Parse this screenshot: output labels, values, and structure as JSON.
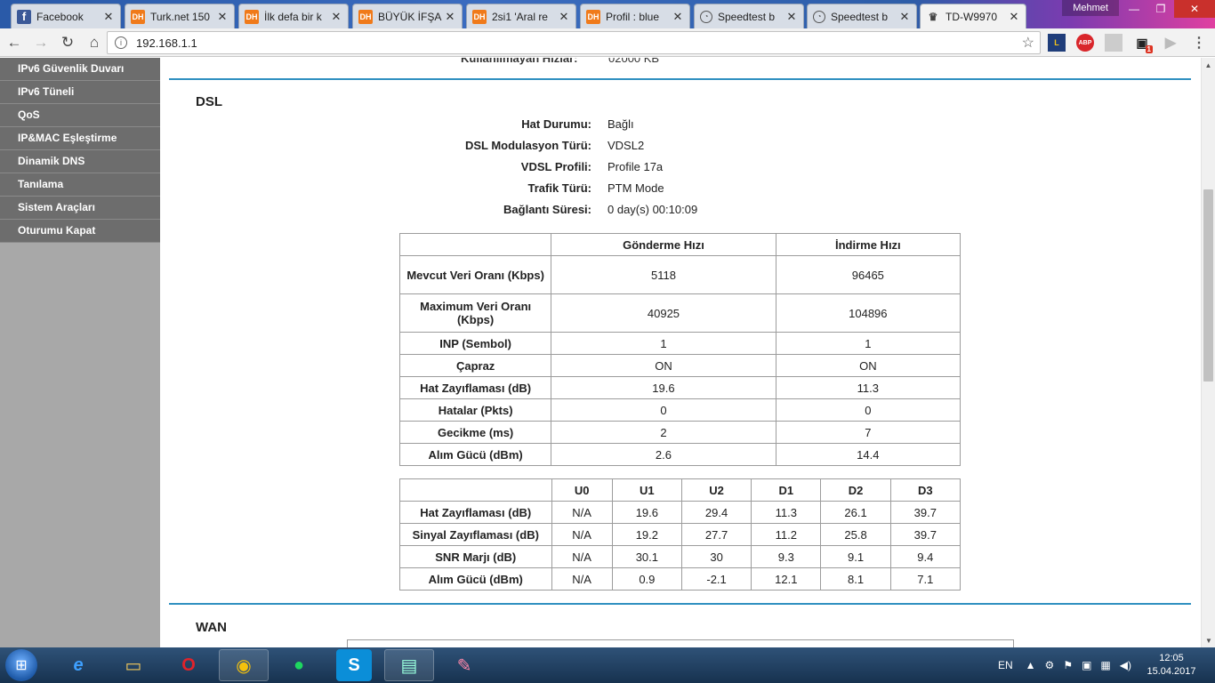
{
  "browser": {
    "tabs": [
      {
        "title": "Facebook",
        "favicon": "facebook-icon",
        "fav_text": "f",
        "active": false
      },
      {
        "title": "Turk.net 150",
        "favicon": "dh-icon",
        "fav_text": "DH",
        "active": false
      },
      {
        "title": "İlk defa bir k",
        "favicon": "dh-icon",
        "fav_text": "DH",
        "active": false
      },
      {
        "title": "BÜYÜK İFŞA",
        "favicon": "dh-icon",
        "fav_text": "DH",
        "active": false
      },
      {
        "title": "2si1 'Aral re",
        "favicon": "dh-icon",
        "fav_text": "DH",
        "active": false
      },
      {
        "title": "Profil : blue",
        "favicon": "dh-icon",
        "fav_text": "DH",
        "active": false
      },
      {
        "title": "Speedtest b",
        "favicon": "speedtest-icon",
        "fav_text": "◔",
        "active": false
      },
      {
        "title": "Speedtest b",
        "favicon": "speedtest-icon",
        "fav_text": "◔",
        "active": false
      },
      {
        "title": "TD-W9970",
        "favicon": "tplink-icon",
        "fav_text": "♛",
        "active": true
      }
    ],
    "close_glyph": "✕",
    "user_name": "Mehmet",
    "window_buttons": {
      "minimize": "—",
      "maximize": "❐",
      "close": "✕"
    },
    "url": "192.168.1.1",
    "nav": {
      "back": "←",
      "forward": "→",
      "reload": "↻",
      "home": "⌂"
    },
    "info_glyph": "i",
    "star_glyph": "☆",
    "extensions": {
      "abp": "ABP",
      "badge": "1"
    }
  },
  "sidebar": {
    "items": [
      "IPv6 Güvenlik Duvarı",
      "IPv6 Tüneli",
      "QoS",
      "IP&MAC Eşleştirme",
      "Dinamik DNS",
      "Tanılama",
      "Sistem Araçları",
      "Oturumu Kapat"
    ]
  },
  "dsl": {
    "title": "DSL",
    "fields": [
      {
        "label": "Hat Durumu:",
        "value": "Bağlı"
      },
      {
        "label": "DSL Modulasyon Türü:",
        "value": "VDSL2"
      },
      {
        "label": "VDSL Profili:",
        "value": "Profile 17a"
      },
      {
        "label": "Trafik Türü:",
        "value": "PTM Mode"
      },
      {
        "label": "Bağlantı Süresi:",
        "value": "0 day(s) 00:10:09"
      }
    ],
    "rate_table": {
      "headers": [
        "",
        "Gönderme Hızı",
        "İndirme Hızı"
      ],
      "rows": [
        {
          "label": "Mevcut Veri Oranı (Kbps)",
          "up": "5118",
          "down": "96465"
        },
        {
          "label": "Maximum Veri Oranı (Kbps)",
          "up": "40925",
          "down": "104896"
        },
        {
          "label": "INP (Sembol)",
          "up": "1",
          "down": "1"
        },
        {
          "label": "Çapraz",
          "up": "ON",
          "down": "ON"
        },
        {
          "label": "Hat Zayıflaması (dB)",
          "up": "19.6",
          "down": "11.3"
        },
        {
          "label": "Hatalar (Pkts)",
          "up": "0",
          "down": "0"
        },
        {
          "label": "Gecikme (ms)",
          "up": "2",
          "down": "7"
        },
        {
          "label": "Alım Gücü (dBm)",
          "up": "2.6",
          "down": "14.4"
        }
      ]
    },
    "band_table": {
      "headers": [
        "",
        "U0",
        "U1",
        "U2",
        "D1",
        "D2",
        "D3"
      ],
      "rows": [
        {
          "label": "Hat Zayıflaması (dB)",
          "values": [
            "N/A",
            "19.6",
            "29.4",
            "11.3",
            "26.1",
            "39.7"
          ]
        },
        {
          "label": "Sinyal Zayıflaması (dB)",
          "values": [
            "N/A",
            "19.2",
            "27.7",
            "11.2",
            "25.8",
            "39.7"
          ]
        },
        {
          "label": "SNR Marjı (dB)",
          "values": [
            "N/A",
            "30.1",
            "30",
            "9.3",
            "9.1",
            "9.4"
          ]
        },
        {
          "label": "Alım Gücü (dBm)",
          "values": [
            "N/A",
            "0.9",
            "-2.1",
            "12.1",
            "8.1",
            "7.1"
          ]
        }
      ]
    }
  },
  "wan": {
    "title": "WAN"
  },
  "taskbar": {
    "lang": "EN",
    "time": "12:05",
    "date": "15.04.2017"
  },
  "colors": {
    "accent_rule": "#2f8fc0",
    "sidebar_item": "#6d6d6d",
    "sidebar_bg": "#a8a8a8"
  }
}
